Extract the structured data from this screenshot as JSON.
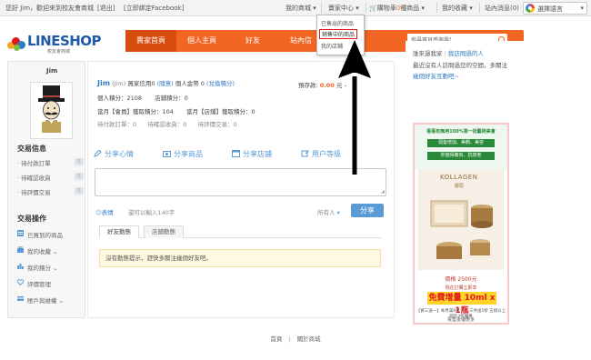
{
  "topbar": {
    "greeting": "您好 Jim，歡迎來到校友會商城",
    "logout": "[退出]",
    "bind_fb": "[立即綁定Facebook]",
    "my_mall": "我的商城",
    "seller_center": "賣家中心",
    "cart_prefix": "購物車",
    "cart_count": "0",
    "cart_suffix": "種商品",
    "favorites": "我的收藏",
    "site_messages": "站內消息",
    "message_count": "(0)",
    "language": "選擇語言"
  },
  "logo": {
    "text": "LINESHOP",
    "subtitle": "校友會商城"
  },
  "nav": {
    "items": [
      "賣家首頁",
      "個人主頁",
      "好友",
      "站內信"
    ],
    "search_placeholder": "搜尋寶貝感興趣！"
  },
  "dropdown": {
    "items": [
      "已售出的商品",
      "銷售中的商品",
      "我的店鋪"
    ]
  },
  "left": {
    "name": "Jim",
    "trade_title": "交易信息",
    "trade_items": [
      {
        "label": "· 待付款訂單",
        "count": "0"
      },
      {
        "label": "· 待確認收貨",
        "count": "0"
      },
      {
        "label": "· 待評價交易",
        "count": "0"
      }
    ],
    "ops_title": "交易操作",
    "ops_items": [
      "已買到的商品",
      "我的收藏 ⌄",
      "我的積分 ⌄",
      "評價管理",
      "賬戶與維權 ⌄"
    ]
  },
  "profile": {
    "name": "Jim",
    "name_paren": "(Jim)",
    "credit_label": "買家信用0",
    "bind_link": "(隨意)",
    "balance_label": "個人金幣 0",
    "exchange_link": "(兌換積分)",
    "prepaid_label": "預存款:",
    "prepaid_value": "0.00",
    "prepaid_unit": "元 -",
    "points_line": "個人積分：2108",
    "store_points": "店鋪積分：0",
    "month_member": "當月【會員】獲取積分：104",
    "month_store": "當月【店鋪】獲取積分：0",
    "pending_pay": "待付款訂單：0",
    "pending_receive": "待確認收貨：0",
    "pending_review": "待評價交易：0"
  },
  "share": {
    "items": [
      "分享心情",
      "分享商品",
      "分享店鋪",
      "用户等级"
    ],
    "emoji_label": "表情",
    "char_hint": "還可以輸入140字",
    "visibility": "所有人",
    "button": "分享"
  },
  "tabs": [
    "好友動態",
    "店鋪動態"
  ],
  "notice": "沒有動態提示，趕快多關注幾個好友吧。",
  "right": {
    "visitors_prefix": "誰來過我家",
    "visitors_link": "我訪問過的人",
    "visitors_desc": "最近沒有人訪問過您的空間，多關注",
    "visitors_desc2": "幾個好友互動吧~",
    "ad_line1": "看看有無用100%第一批藝術美會",
    "ad_line2": "頭髮增加、美顏、美容",
    "ad_line3": "你值得擁有、抗衰老",
    "ad_brand": "KOLLAGEN",
    "ad_brand_sub": "膠原",
    "ad_price": "價格 2500元",
    "ad_free": "免費增量 10ml x 1瓶",
    "ad_foot1": "現在訂購立即享",
    "ad_foot2": "【買三送一】本月滿9折 二、三件送5折 五組以上即享3折優惠",
    "ad_foot3": "買售後優惠多"
  },
  "footer": {
    "home": "首頁",
    "sep": "|",
    "about": "關於商城"
  },
  "colors": {
    "accent": "#f26522",
    "blue": "#2f7bc2",
    "share_blue": "#5b9bd5"
  }
}
